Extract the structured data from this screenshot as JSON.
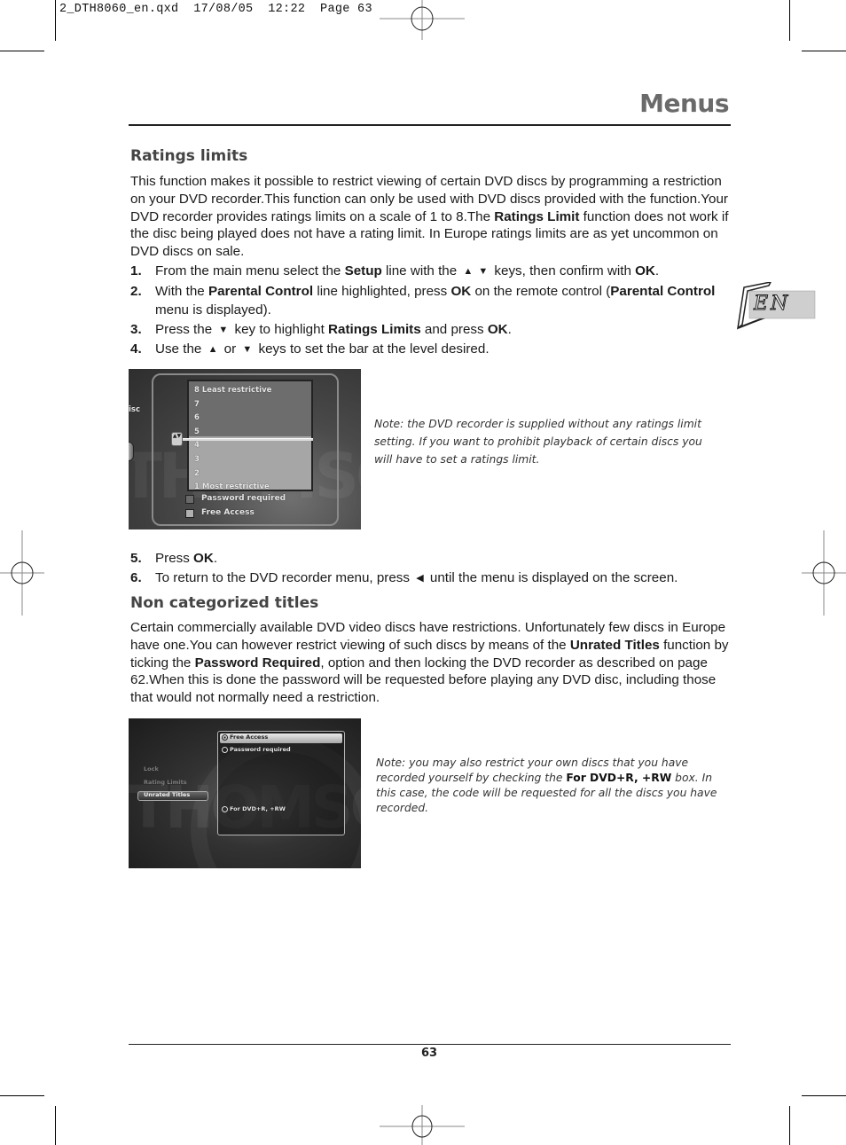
{
  "slug": "2_DTH8060_en.qxd  17/08/05  12:22  Page 63",
  "header": {
    "title": "Menus"
  },
  "language_tab": {
    "label": "EN"
  },
  "ratings_section": {
    "heading": "Ratings limits",
    "intro": [
      {
        "t": "This function makes it possible to restrict viewing of certain DVD discs by programming a restriction on your DVD recorder.This function can only be used with DVD discs provided with the function.Your DVD recorder provides ratings limits on a scale of 1 to 8.The "
      },
      {
        "t": "Ratings Limit",
        "b": true
      },
      {
        "t": " function does not work if the disc being played does not have a rating limit. In Europe ratings limits are as yet uncommon on DVD discs on sale."
      }
    ],
    "steps": [
      {
        "num": "1.",
        "parts": [
          {
            "t": "From the main menu select the "
          },
          {
            "t": "Setup",
            "b": true
          },
          {
            "t": " line with the "
          },
          {
            "key": "▲"
          },
          {
            "key": "▼"
          },
          {
            "t": " keys, then confirm with "
          },
          {
            "t": "OK",
            "b": true
          },
          {
            "t": "."
          }
        ]
      },
      {
        "num": "2.",
        "parts": [
          {
            "t": "With the "
          },
          {
            "t": "Parental Control",
            "b": true
          },
          {
            "t": " line highlighted, press "
          },
          {
            "t": "OK",
            "b": true
          },
          {
            "t": " on the remote control ("
          },
          {
            "t": "Parental Control",
            "b": true
          },
          {
            "t": " menu is displayed)."
          }
        ]
      },
      {
        "num": "3.",
        "parts": [
          {
            "t": "Press the "
          },
          {
            "key": "▼"
          },
          {
            "t": " key to highlight "
          },
          {
            "t": "Ratings Limits",
            "b": true
          },
          {
            "t": " and press "
          },
          {
            "t": "OK",
            "b": true
          },
          {
            "t": "."
          }
        ]
      },
      {
        "num": "4.",
        "parts": [
          {
            "t": "Use the "
          },
          {
            "key": "▲"
          },
          {
            "t": " or "
          },
          {
            "key": "▼"
          },
          {
            "t": " keys to set the bar at the level desired."
          }
        ]
      }
    ],
    "screenshot": {
      "side_label": "isc",
      "levels": [
        "8 Least restrictive",
        "7",
        "6",
        "5",
        "4",
        "3",
        "2",
        "1 Most restrictive"
      ],
      "selected_level": 4.5,
      "handle_glyph": "▲▼",
      "checkboxes": [
        {
          "label": "Password required",
          "checked": false
        },
        {
          "label": "Free Access",
          "checked": false
        }
      ]
    },
    "note": "Note: the DVD recorder is supplied without any ratings limit setting. If you want to prohibit playback of certain discs you will have to set a ratings limit.",
    "steps_after": [
      {
        "num": "5.",
        "parts": [
          {
            "t": "Press "
          },
          {
            "t": "OK",
            "b": true
          },
          {
            "t": "."
          }
        ]
      },
      {
        "num": "6.",
        "parts": [
          {
            "t": "To return to the DVD recorder menu, press "
          },
          {
            "key": "◀"
          },
          {
            "t": " until the menu is displayed on the screen."
          }
        ]
      }
    ]
  },
  "noncat_section": {
    "heading": "Non categorized titles",
    "body": [
      {
        "t": "Certain commercially available DVD video discs have restrictions. Unfortunately few discs in Europe have one.You can however restrict viewing of such discs by means of the "
      },
      {
        "t": "Unrated Titles",
        "b": true
      },
      {
        "t": " function by ticking the "
      },
      {
        "t": "Password Required",
        "b": true
      },
      {
        "t": ", option and then locking the DVD recorder as described on page 62.When this is done the password will be requested before playing any DVD disc, including those that would not normally need a restriction."
      }
    ],
    "screenshot": {
      "side_items": [
        "Lock",
        "Rating Limits",
        "Unrated Titles"
      ],
      "side_selected": "Unrated Titles",
      "options": [
        {
          "label": "Free Access",
          "selected": true
        },
        {
          "label": "Password required",
          "selected": false
        }
      ],
      "extra_option": {
        "label": "For DVD+R, +RW",
        "selected": false
      },
      "watermark": "THOMSON"
    },
    "note": [
      {
        "t": "Note: you may also restrict your own discs that you have recorded yourself by checking the "
      },
      {
        "t": "For DVD+R, +RW",
        "b": true
      },
      {
        "t": " box. In this case, the code will be requested for all the discs you have recorded."
      }
    ]
  },
  "footer": {
    "page_number": "63"
  }
}
